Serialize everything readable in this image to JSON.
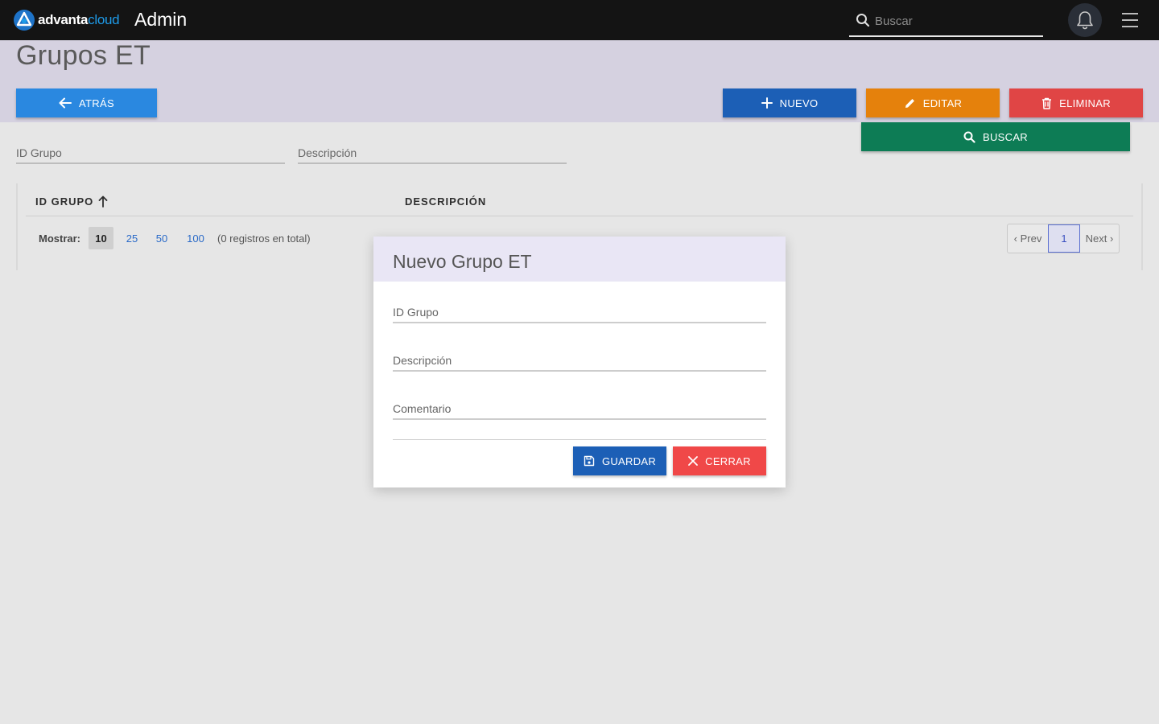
{
  "topbar": {
    "logo_text_main": "advanta",
    "logo_text_accent": "cloud",
    "app_title": "Admin",
    "search_placeholder": "Buscar"
  },
  "page": {
    "title": "Grupos ET"
  },
  "actions": {
    "back_label": "ATRÁS",
    "new_label": "NUEVO",
    "edit_label": "EDITAR",
    "delete_label": "ELIMINAR",
    "search_label": "BUSCAR"
  },
  "filters": {
    "id_placeholder": "ID Grupo",
    "desc_placeholder": "Descripción"
  },
  "table": {
    "columns": [
      {
        "label": "ID GRUPO",
        "sort": "ascending"
      },
      {
        "label": "DESCRIPCIÓN"
      }
    ],
    "show_label": "Mostrar:",
    "page_sizes": [
      "10",
      "25",
      "50",
      "100"
    ],
    "selected_page_size": "10",
    "total_text": "(0 registros en total)",
    "pagination": {
      "prev_label": "‹ Prev",
      "current_page": "1",
      "next_label": "Next ›"
    }
  },
  "modal": {
    "title": "Nuevo Grupo ET",
    "fields": [
      {
        "placeholder": "ID Grupo",
        "value": ""
      },
      {
        "placeholder": "Descripción",
        "value": ""
      },
      {
        "placeholder": "Comentario",
        "value": ""
      }
    ],
    "save_label": "GUARDAR",
    "close_label": "CERRAR"
  },
  "colors": {
    "topbar": "#141414",
    "header_band": "#d5d1e0",
    "back": "#2a88e0",
    "new": "#1c5fb6",
    "edit": "#e5810c",
    "delete": "#e04545",
    "search": "#0d7c55",
    "accent_cloud": "#1e9be9",
    "close": "#f04848"
  }
}
